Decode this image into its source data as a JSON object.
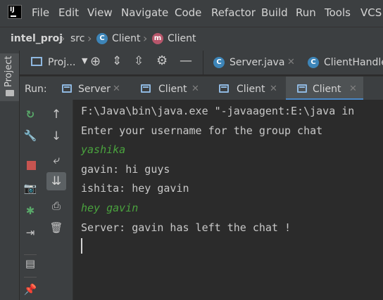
{
  "menubar": {
    "items": [
      "File",
      "Edit",
      "View",
      "Navigate",
      "Code",
      "Refactor",
      "Build",
      "Run",
      "Tools",
      "VCS"
    ],
    "logo_text": "IJ"
  },
  "breadcrumb": {
    "project": "intel_proj",
    "folder": "src",
    "class_file": "Client",
    "method": "Client"
  },
  "left_strip": {
    "project_label": "Project"
  },
  "project_toolbar": {
    "dropdown_label": "Proj...",
    "editor_tabs": [
      "Server.java",
      "ClientHandle"
    ]
  },
  "run_window": {
    "label": "Run:",
    "tabs": [
      "Server",
      "Client",
      "Client",
      "Client"
    ],
    "active_tab_index": 3
  },
  "console": {
    "lines": [
      "F:\\Java\\bin\\java.exe \"-javaagent:E:\\java in",
      "Enter your username for the group chat",
      "yashika",
      "gavin: hi guys",
      "ishita: hey gavin",
      "hey gavin",
      "Server: gavin has left the chat !"
    ],
    "user_input_line_indexes": [
      2,
      5
    ]
  },
  "colors": {
    "background": "#2b2b2b",
    "panel": "#3c3f41",
    "active_tab_underline": "#4a88c7",
    "user_input_text": "#4aa33e",
    "rerun_icon": "#59a869",
    "stop_icon": "#c75450"
  }
}
